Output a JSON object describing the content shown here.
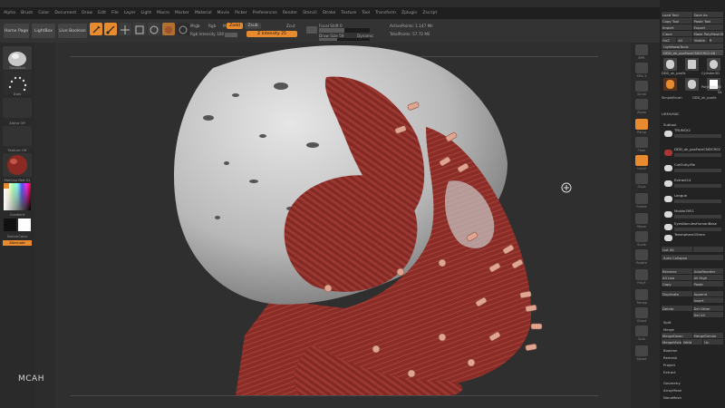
{
  "menu": [
    "Alpha",
    "Brush",
    "Color",
    "Document",
    "Draw",
    "Edit",
    "File",
    "Layer",
    "Light",
    "Macro",
    "Marker",
    "Material",
    "Movie",
    "Picker",
    "Preferences",
    "Render",
    "Stencil",
    "Stroke",
    "Texture",
    "Tool",
    "Transform",
    "Zplugin",
    "Zscript"
  ],
  "shelf": {
    "home_label": "Home Page",
    "lightbox_label": "LightBox",
    "liveboolean_label": "Live Boolean",
    "draw_label": "Draw",
    "move_label": "Move",
    "scale_label": "Scale",
    "rotate_label": "Rotate",
    "mrgb_label": "Mrgb",
    "rgb_label": "Rgb",
    "m_label": "M",
    "rgb_intensity": "Rgb Intensity 100",
    "zadd_label": "Zadd",
    "zsub_label": "Zsub",
    "zcut_label": "Zcut",
    "z_intensity": "Z Intensity 25",
    "focal_shift": "Focal Shift 0",
    "draw_size": "Draw Size 59",
    "dynamic_label": "Dynamic",
    "active_points": "ActivePoints: 1.147 Mil",
    "total_points": "TotalPoints: 57.72 Mil"
  },
  "left": {
    "brush_caption": "Standard",
    "stroke_caption": "Dots",
    "alpha_caption": "Alpha Off",
    "texture_caption": "Texture Off",
    "material_caption": "MatCap Red 01",
    "gradient_caption": "Gradient",
    "switch_caption": "SwitchColor",
    "alternate_label": "Alternate"
  },
  "viewport": {
    "watermark": "MCAH"
  },
  "right": [
    "BPR",
    "SPix 3",
    "Scroll",
    "Zoom",
    "Actual",
    "AAHalf",
    "Persp",
    "Floor",
    "Local",
    "L.Sym",
    "Gxyz",
    "Frame",
    "Move",
    "Scale",
    "Rotate",
    "Line Fill",
    "PolyF",
    "Transp",
    "Ghost",
    "Solo",
    "Xpose"
  ],
  "tray": {
    "load_tool": "Load Tool",
    "save_as": "Save As",
    "copy_tool": "Copy Tool",
    "paste_tool": "Paste Tool",
    "import": "Import",
    "export": "Export",
    "clone": "Clone",
    "make_polymesh": "Make PolyMesh3D",
    "goz": "GoZ",
    "all": "All",
    "visible": "Visible",
    "r": "R",
    "lightbox_tools": "Lightbox▸Tools",
    "current_tool": "DDD_ok_posFaceCNDCR02:48",
    "tool_captions": [
      "DDD_ok_posFa",
      "Cylinder3D",
      "PolyMesh3D",
      "SimpleBrush",
      "DDD_ok_posFa",
      "LiftMicMAC"
    ],
    "tool_count": "54",
    "subtool_header": "Subtool",
    "subtools": [
      "TRUNCK1",
      "DDD_ok_posFaceCNDCR02",
      "CutOutly.Me",
      "Extract14",
      "Langue",
      "Mokke3951",
      "EyesNoculesHumanBase",
      "Teeshphere15mm"
    ],
    "list_all": "List All",
    "auto_collapse": "Auto Collapse",
    "rename": "Rename",
    "autoreorder": "AutoReorder",
    "all_low": "All Low",
    "all_high": "All High",
    "copy": "Copy",
    "paste": "Paste",
    "duplicate": "Duplicate",
    "append": "Append",
    "insert": "Insert",
    "delete": "Delete",
    "del_other": "Del Other",
    "del_all": "Del All",
    "split": "Split",
    "merge": "Merge",
    "merge_down": "MergeDown",
    "merge_similar": "MergeSimilar",
    "merge_visible": "MergeVisible",
    "weld": "Weld",
    "uv": "Uv",
    "boolean": "Boolean",
    "remesh": "Remesh",
    "project": "Project",
    "extract": "Extract",
    "geometry": "Geometry",
    "arraymesh": "ArrayMesh",
    "nanomesh": "NanoMesh"
  }
}
